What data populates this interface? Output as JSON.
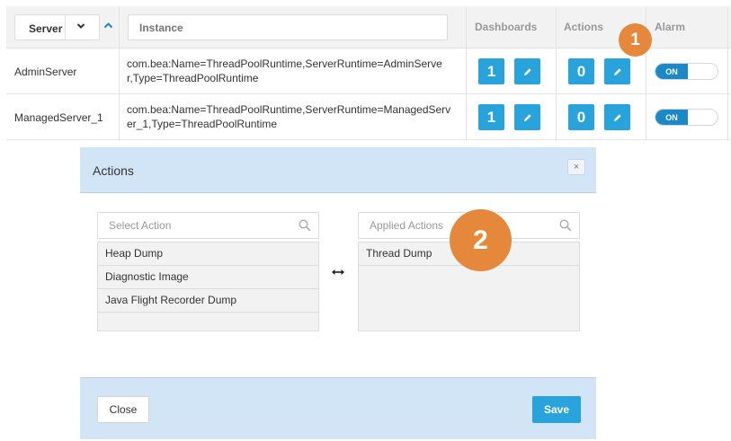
{
  "table": {
    "headers": {
      "server": "Server",
      "instance_placeholder": "Instance",
      "dashboards": "Dashboards",
      "actions": "Actions",
      "alarm": "Alarm"
    },
    "rows": [
      {
        "server": "AdminServer",
        "instance_line1": "com.bea:Name=ThreadPoolRuntime,ServerRuntime=AdminServe",
        "instance_line2": "r,Type=ThreadPoolRuntime",
        "dashboards_count": "1",
        "actions_count": "0",
        "alarm": "ON"
      },
      {
        "server": "ManagedServer_1",
        "instance_line1": "com.bea:Name=ThreadPoolRuntime,ServerRuntime=ManagedServ",
        "instance_line2": "er_1,Type=ThreadPoolRuntime",
        "dashboards_count": "1",
        "actions_count": "0",
        "alarm": "ON"
      }
    ]
  },
  "callouts": {
    "one": "1",
    "two": "2"
  },
  "modal": {
    "title": "Actions",
    "close_x": "×",
    "select_placeholder": "Select Action",
    "applied_placeholder": "Applied Actions",
    "available_actions": [
      "Heap Dump",
      "Diagnostic Image",
      "Java Flight Recorder Dump"
    ],
    "applied_actions": [
      "Thread Dump"
    ],
    "close_label": "Close",
    "save_label": "Save"
  },
  "colors": {
    "accent": "#29a3dc",
    "toggle_on": "#1b88c9",
    "callout": "#e5883c",
    "modal_band": "#d2e5f6"
  },
  "icons": [
    "chevron-down-icon",
    "sort-up-icon",
    "pencil-icon",
    "close-icon",
    "search-icon",
    "swap-arrows-icon"
  ]
}
